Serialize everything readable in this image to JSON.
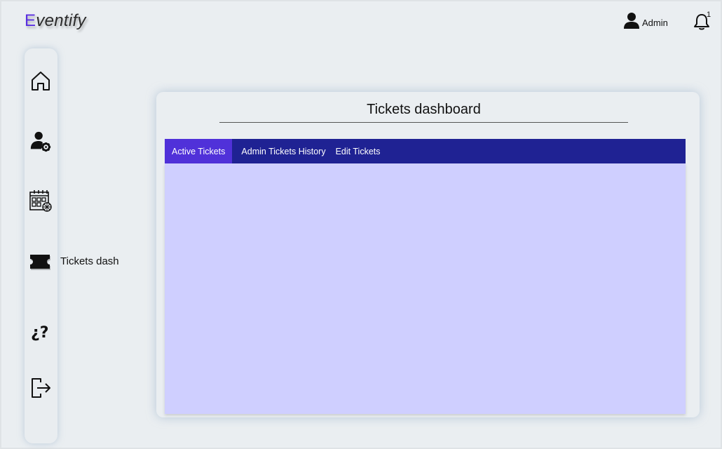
{
  "app": {
    "logo_first": "E",
    "logo_rest": "ventify"
  },
  "header": {
    "user_label": "Admin",
    "notification_count": "1"
  },
  "sidebar": {
    "items": [
      {
        "icon": "home-icon"
      },
      {
        "icon": "user-settings-icon"
      },
      {
        "icon": "calendar-icon"
      },
      {
        "icon": "ticket-icon",
        "label": "Tickets dash"
      },
      {
        "icon": "help-icon"
      },
      {
        "icon": "logout-icon"
      }
    ]
  },
  "main": {
    "title": "Tickets dashboard",
    "tabs": [
      {
        "label": "Active Tickets",
        "active": true
      },
      {
        "label": "Admin Tickets History",
        "active": false
      },
      {
        "label": "Edit Tickets",
        "active": false
      }
    ]
  },
  "colors": {
    "accent": "#5031d9",
    "tab_bar": "#1f2293",
    "content_bg": "#cfcfff",
    "page_bg": "#eaeef1"
  }
}
